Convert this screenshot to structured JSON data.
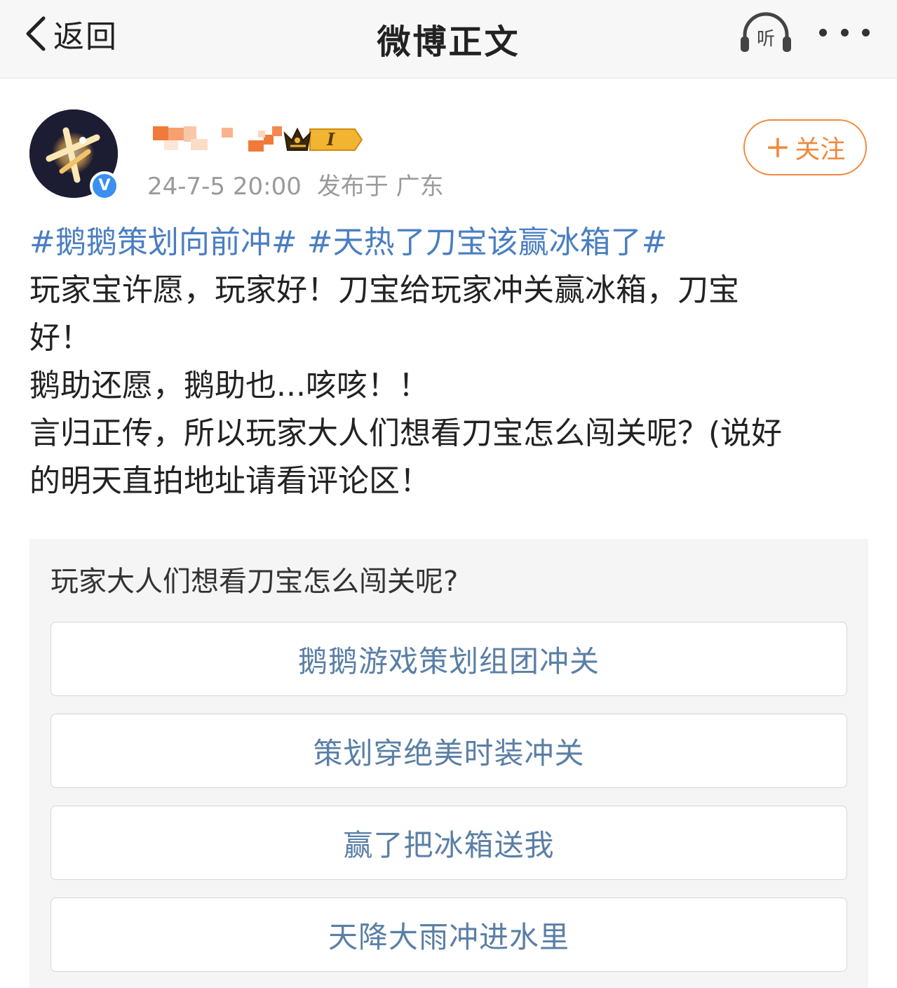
{
  "navbar": {
    "back_label": "返回",
    "title": "微博正文",
    "listen_label": "听"
  },
  "author": {
    "timestamp": "24-7-5 20:00",
    "location": "发布于 广东",
    "rank_label": "I",
    "verified_mark": "V"
  },
  "follow_button": {
    "plus": "+",
    "label": "关注"
  },
  "post": {
    "topics": [
      "#鹅鹅策划向前冲#",
      "#天热了刀宝该赢冰箱了#"
    ],
    "lines": [
      "玩家宝许愿，玩家好！刀宝给玩家冲关赢冰箱，刀宝",
      "好！",
      "鹅助还愿，鹅助也...咳咳！！",
      "言归正传，所以玩家大人们想看刀宝怎么闯关呢？(说好",
      "的明天直拍地址请看评论区！"
    ]
  },
  "poll": {
    "question": "玩家大人们想看刀宝怎么闯关呢?",
    "options": [
      "鹅鹅游戏策划组团冲关",
      "策划穿绝美时装冲关",
      "赢了把冰箱送我",
      "天降大雨冲进水里"
    ]
  },
  "colors": {
    "topic_link": "#4a7ec2",
    "follow_accent": "#f08a3c",
    "poll_option_text": "#5a7fa6",
    "verified_blue": "#3a8ff0"
  }
}
